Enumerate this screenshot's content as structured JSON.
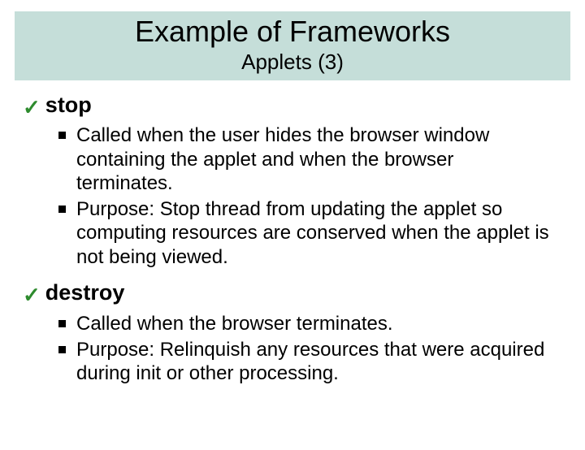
{
  "title": "Example of Frameworks",
  "subtitle": "Applets (3)",
  "sections": [
    {
      "name": "stop",
      "bullets": [
        "Called when the user hides the browser window containing the applet and when the browser terminates.",
        "Purpose: Stop thread from updating the applet so computing resources are conserved when the applet is not being viewed."
      ]
    },
    {
      "name": "destroy",
      "bullets": [
        "Called when the browser terminates.",
        "Purpose: Relinquish any resources that were acquired during init or other processing."
      ]
    }
  ]
}
